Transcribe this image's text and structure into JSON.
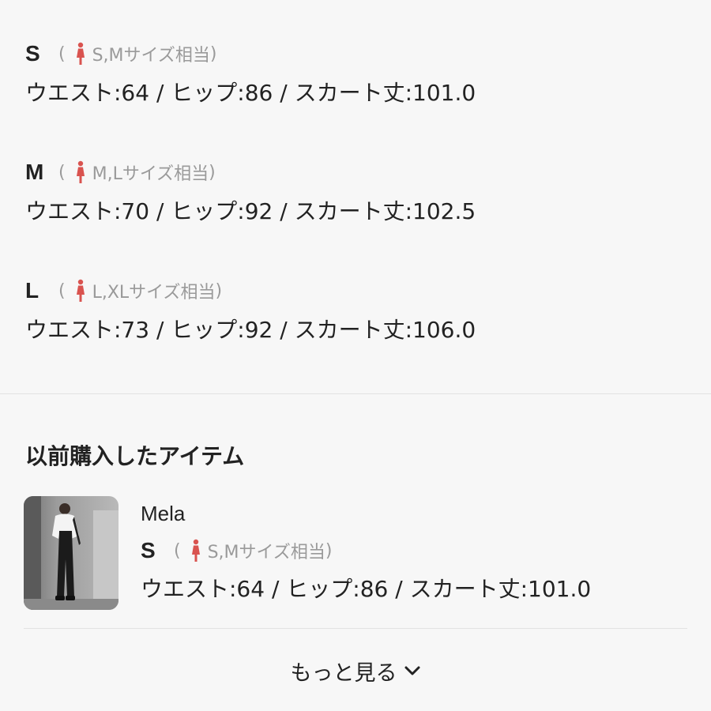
{
  "sizes": [
    {
      "label": "S",
      "equivalent": "S,Mサイズ相当",
      "measurements": "ウエスト:64 / ヒップ:86 / スカート丈:101.0"
    },
    {
      "label": "M",
      "equivalent": "M,Lサイズ相当",
      "measurements": "ウエスト:70 / ヒップ:92 / スカート丈:102.5"
    },
    {
      "label": "L",
      "equivalent": "L,XLサイズ相当",
      "measurements": "ウエスト:73 / ヒップ:92 / スカート丈:106.0"
    }
  ],
  "paren_open": "(",
  "paren_close": ")",
  "previous": {
    "title": "以前購入したアイテム",
    "item": {
      "brand": "Mela",
      "size_label": "S",
      "equivalent": "S,Mサイズ相当",
      "measurements": "ウエスト:64 / ヒップ:86 / スカート丈:101.0"
    }
  },
  "more": {
    "label": "もっと見る",
    "icon": "chevron-down-icon"
  },
  "colors": {
    "figure_icon": "#d9534f",
    "muted_text": "#9a9a9a",
    "background": "#f7f7f7"
  }
}
